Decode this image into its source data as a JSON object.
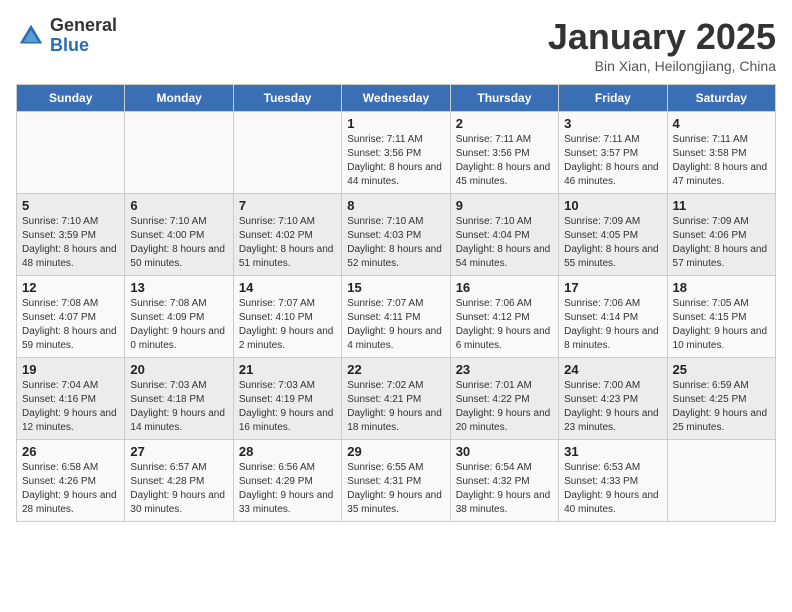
{
  "header": {
    "logo_general": "General",
    "logo_blue": "Blue",
    "title": "January 2025",
    "subtitle": "Bin Xian, Heilongjiang, China"
  },
  "days_of_week": [
    "Sunday",
    "Monday",
    "Tuesday",
    "Wednesday",
    "Thursday",
    "Friday",
    "Saturday"
  ],
  "weeks": [
    [
      {
        "day": "",
        "info": ""
      },
      {
        "day": "",
        "info": ""
      },
      {
        "day": "",
        "info": ""
      },
      {
        "day": "1",
        "info": "Sunrise: 7:11 AM\nSunset: 3:56 PM\nDaylight: 8 hours\nand 44 minutes."
      },
      {
        "day": "2",
        "info": "Sunrise: 7:11 AM\nSunset: 3:56 PM\nDaylight: 8 hours\nand 45 minutes."
      },
      {
        "day": "3",
        "info": "Sunrise: 7:11 AM\nSunset: 3:57 PM\nDaylight: 8 hours\nand 46 minutes."
      },
      {
        "day": "4",
        "info": "Sunrise: 7:11 AM\nSunset: 3:58 PM\nDaylight: 8 hours\nand 47 minutes."
      }
    ],
    [
      {
        "day": "5",
        "info": "Sunrise: 7:10 AM\nSunset: 3:59 PM\nDaylight: 8 hours\nand 48 minutes."
      },
      {
        "day": "6",
        "info": "Sunrise: 7:10 AM\nSunset: 4:00 PM\nDaylight: 8 hours\nand 50 minutes."
      },
      {
        "day": "7",
        "info": "Sunrise: 7:10 AM\nSunset: 4:02 PM\nDaylight: 8 hours\nand 51 minutes."
      },
      {
        "day": "8",
        "info": "Sunrise: 7:10 AM\nSunset: 4:03 PM\nDaylight: 8 hours\nand 52 minutes."
      },
      {
        "day": "9",
        "info": "Sunrise: 7:10 AM\nSunset: 4:04 PM\nDaylight: 8 hours\nand 54 minutes."
      },
      {
        "day": "10",
        "info": "Sunrise: 7:09 AM\nSunset: 4:05 PM\nDaylight: 8 hours\nand 55 minutes."
      },
      {
        "day": "11",
        "info": "Sunrise: 7:09 AM\nSunset: 4:06 PM\nDaylight: 8 hours\nand 57 minutes."
      }
    ],
    [
      {
        "day": "12",
        "info": "Sunrise: 7:08 AM\nSunset: 4:07 PM\nDaylight: 8 hours\nand 59 minutes."
      },
      {
        "day": "13",
        "info": "Sunrise: 7:08 AM\nSunset: 4:09 PM\nDaylight: 9 hours\nand 0 minutes."
      },
      {
        "day": "14",
        "info": "Sunrise: 7:07 AM\nSunset: 4:10 PM\nDaylight: 9 hours\nand 2 minutes."
      },
      {
        "day": "15",
        "info": "Sunrise: 7:07 AM\nSunset: 4:11 PM\nDaylight: 9 hours\nand 4 minutes."
      },
      {
        "day": "16",
        "info": "Sunrise: 7:06 AM\nSunset: 4:12 PM\nDaylight: 9 hours\nand 6 minutes."
      },
      {
        "day": "17",
        "info": "Sunrise: 7:06 AM\nSunset: 4:14 PM\nDaylight: 9 hours\nand 8 minutes."
      },
      {
        "day": "18",
        "info": "Sunrise: 7:05 AM\nSunset: 4:15 PM\nDaylight: 9 hours\nand 10 minutes."
      }
    ],
    [
      {
        "day": "19",
        "info": "Sunrise: 7:04 AM\nSunset: 4:16 PM\nDaylight: 9 hours\nand 12 minutes."
      },
      {
        "day": "20",
        "info": "Sunrise: 7:03 AM\nSunset: 4:18 PM\nDaylight: 9 hours\nand 14 minutes."
      },
      {
        "day": "21",
        "info": "Sunrise: 7:03 AM\nSunset: 4:19 PM\nDaylight: 9 hours\nand 16 minutes."
      },
      {
        "day": "22",
        "info": "Sunrise: 7:02 AM\nSunset: 4:21 PM\nDaylight: 9 hours\nand 18 minutes."
      },
      {
        "day": "23",
        "info": "Sunrise: 7:01 AM\nSunset: 4:22 PM\nDaylight: 9 hours\nand 20 minutes."
      },
      {
        "day": "24",
        "info": "Sunrise: 7:00 AM\nSunset: 4:23 PM\nDaylight: 9 hours\nand 23 minutes."
      },
      {
        "day": "25",
        "info": "Sunrise: 6:59 AM\nSunset: 4:25 PM\nDaylight: 9 hours\nand 25 minutes."
      }
    ],
    [
      {
        "day": "26",
        "info": "Sunrise: 6:58 AM\nSunset: 4:26 PM\nDaylight: 9 hours\nand 28 minutes."
      },
      {
        "day": "27",
        "info": "Sunrise: 6:57 AM\nSunset: 4:28 PM\nDaylight: 9 hours\nand 30 minutes."
      },
      {
        "day": "28",
        "info": "Sunrise: 6:56 AM\nSunset: 4:29 PM\nDaylight: 9 hours\nand 33 minutes."
      },
      {
        "day": "29",
        "info": "Sunrise: 6:55 AM\nSunset: 4:31 PM\nDaylight: 9 hours\nand 35 minutes."
      },
      {
        "day": "30",
        "info": "Sunrise: 6:54 AM\nSunset: 4:32 PM\nDaylight: 9 hours\nand 38 minutes."
      },
      {
        "day": "31",
        "info": "Sunrise: 6:53 AM\nSunset: 4:33 PM\nDaylight: 9 hours\nand 40 minutes."
      },
      {
        "day": "",
        "info": ""
      }
    ]
  ]
}
